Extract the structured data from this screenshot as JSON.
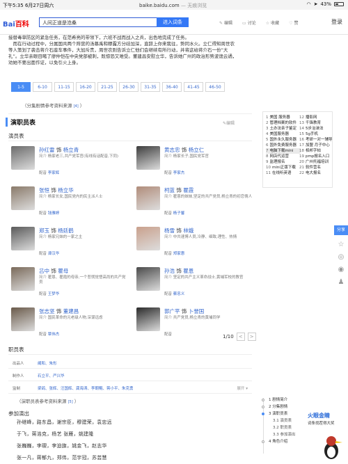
{
  "status_bar": {
    "time": "下午5:35",
    "date": "6月27日周六",
    "url": "baike.baidu.com",
    "mode": "— 无痕浏览",
    "battery": "43%",
    "battery_level": 0.43
  },
  "header": {
    "logo_main": "Bai",
    "logo_du": "百科",
    "search_value": "人间正道是沧桑",
    "search_button": "进入词条",
    "actions": [
      {
        "icon": "edit-icon",
        "label": "编辑"
      },
      {
        "icon": "discuss-icon",
        "label": "讨论"
      },
      {
        "icon": "favorite-icon",
        "label": "收藏"
      },
      {
        "icon": "like-icon",
        "label": "赞"
      }
    ],
    "login": "登录"
  },
  "intro": [
    "接替毒草防区的紧急任务，在范希亮的带领下，六班不战而战入之兵，出色地完成了任务。",
    "　而在行动过程中，分属国共两个阵营的汤慕禹和穆露方分歧加深，直辞上你来我往，势同水火。立仁得知周世农等人策划了袭击蒋介石座车事件，大加斥责，周世农则告诉立仁他们会继续有所行动，并将这给蒋介石一份“大礼”。立华亲眼目睹了廖仲恺在中央党部被刺，既惊恐又难受。董建昌安慰立华，告诉她广州的政治形势波诡云谲，劝她不要出面作证，以免引火上身。"
  ],
  "episode_tabs": [
    "1-5",
    "6-10",
    "11-15",
    "16-20",
    "21-25",
    "26-30",
    "31-35",
    "36-40",
    "41-45",
    "46-50"
  ],
  "episode_source": "（分集剧情参考资料来源",
  "episode_source_ref": "[4]",
  "episode_source_close": "）",
  "cast_section": {
    "title": "演职员表",
    "edit": "编辑",
    "sub_title": "演员表"
  },
  "actors": [
    {
      "actor": "孙红雷",
      "as": "饰",
      "role": "杨立青",
      "intro_label": "简介",
      "intro": "杨家老三,共产党军官(有线有话配音,下同)",
      "dub_label": "配音",
      "dub": "李家辉"
    },
    {
      "actor": "黄志忠",
      "as": "饰",
      "role": "杨立仁",
      "intro_label": "简介",
      "intro": "杨家长子,国民党军官",
      "dub_label": "配音",
      "dub": "李家杰"
    },
    {
      "actor": "张恒",
      "as": "饰",
      "role": "杨立华",
      "intro_label": "简介",
      "intro": "杨家长女,国民党内的民主派人士",
      "dub_label": "配音",
      "dub": "钱雅婷"
    },
    {
      "actor": "柯蓝",
      "as": "饰",
      "role": "瞿霞",
      "intro_label": "简介",
      "intro": "瞿恩的妹妹,坚定的共产党员,杨立青的初恋情人",
      "dub_label": "配音",
      "dub": "杨子馨"
    },
    {
      "actor": "郑玉",
      "as": "饰",
      "role": "杨廷鹤",
      "intro_label": "简介",
      "intro": "杨家兄妹的一家之主",
      "dub_label": "配音",
      "dub": "谭汉华"
    },
    {
      "actor": "杨雪",
      "as": "饰",
      "role": "林娥",
      "intro_label": "简介",
      "intro": "中共速博人员,冷静、细致,理性、热情",
      "dub_label": "配音",
      "dub": "郑家惠"
    },
    {
      "actor": "吕中",
      "as": "饰",
      "role": "瞿母",
      "intro_label": "简介",
      "intro": "瞿恩、瞿霞的母亲,一个悲悯觉悟高尚的共产党员",
      "dub_label": "配音",
      "dub": "王梦华"
    },
    {
      "actor": "孙浩",
      "as": "饰",
      "role": "瞿恩",
      "intro_label": "简介",
      "intro": "坚定的共产主义革命战士,黄埔军校的教官",
      "dub_label": "配音",
      "dub": "蔡忠义"
    },
    {
      "actor": "张志坚",
      "as": "饰",
      "role": "董建昌",
      "intro_label": "简介",
      "intro": "国民革命的元老级人物,深谋远虑",
      "dub_label": "配音",
      "dub": "覃伟杰"
    },
    {
      "actor": "郭广平",
      "as": "饰",
      "role": "卜誉国",
      "intro_label": "简介",
      "intro": "共产党员,杨立青的黄埔同学",
      "dub_label": "配音",
      "dub": ""
    }
  ],
  "pager": {
    "text": "1/10",
    "prev": "<",
    "next": ">"
  },
  "staff": {
    "title": "职员表",
    "rows": [
      {
        "label": "出品人",
        "value": "阚和、朱彤",
        "more": ""
      },
      {
        "label": "制作人",
        "value": "石立平、严兴华",
        "more": ""
      },
      {
        "label": "监制",
        "value": "梁鸽、张辉、汪国辉、龚海涛、李朝鲲、蒋小平、朱克勇",
        "more": "展开 ▾"
      }
    ],
    "source": "（演职员表参考资料来源",
    "source_ref": "[5]",
    "source_close": "）"
  },
  "join": {
    "title": "参加演出",
    "lines": [
      "孙继峰，路东昌，谢宗臣，穆建荣，袁忠远",
      "于飞，蒋浩克，杨艺 张雁，姚建隆",
      "张巍巍，李碶，李迫旗，姚金飞，赵志华",
      "张一凡，蒋郁九，郑伟，范宇冠，苏芸慧"
    ]
  },
  "right_list": {
    "left": [
      {
        "n": "1",
        "t": "美国 服务器"
      },
      {
        "n": "2",
        "t": "管理档案的软件"
      },
      {
        "n": "3",
        "t": "土办法亲子鉴定"
      },
      {
        "n": "4",
        "t": "美国服务器"
      },
      {
        "n": "5",
        "t": "国外永久服务器"
      },
      {
        "n": "6",
        "t": "国外免费服务器"
      },
      {
        "n": "7",
        "t": "电脑下载mini"
      },
      {
        "n": "8",
        "t": "网店代运营"
      },
      {
        "n": "9",
        "t": "监理报名"
      },
      {
        "n": "10",
        "t": "mini正版下载"
      },
      {
        "n": "11",
        "t": "在线听英语"
      }
    ],
    "right": [
      {
        "n": "12",
        "t": "播影网"
      },
      {
        "n": "13",
        "t": "千锋教育"
      },
      {
        "n": "14",
        "t": "5步治澡法"
      },
      {
        "n": "15",
        "t": "5g手机"
      },
      {
        "n": "16",
        "t": "考研一对一辅导"
      },
      {
        "n": "17",
        "t": "加盟 月子中心"
      },
      {
        "n": "18",
        "t": "相邦字帖"
      },
      {
        "n": "19",
        "t": "pmp报名入口"
      },
      {
        "n": "20",
        "t": "广州托福培训"
      },
      {
        "n": "21",
        "t": "软件营名"
      },
      {
        "n": "22",
        "t": "电大报名"
      }
    ]
  },
  "share": {
    "label": "分享"
  },
  "outline": [
    {
      "n": "1",
      "t": "剧情简介",
      "sub": false,
      "active": false
    },
    {
      "n": "2",
      "t": "分集剧情",
      "sub": false,
      "active": false
    },
    {
      "n": "3",
      "t": "演职员表",
      "sub": false,
      "active": true
    },
    {
      "n": "3.1",
      "t": "演员表",
      "sub": true,
      "active": false
    },
    {
      "n": "3.2",
      "t": "职员表",
      "sub": true,
      "active": false
    },
    {
      "n": "3.3",
      "t": "参加演出",
      "sub": true,
      "active": false
    },
    {
      "n": "4",
      "t": "角色介绍",
      "sub": false,
      "active": false
    }
  ],
  "ad": {
    "title": "火眼金睛",
    "text": "词条找茬得大奖"
  },
  "colors": {
    "brand_blue": "#2f5cd6",
    "link": "#3366cc",
    "accent": "#4a8df5",
    "logo_red": "#e00000"
  }
}
